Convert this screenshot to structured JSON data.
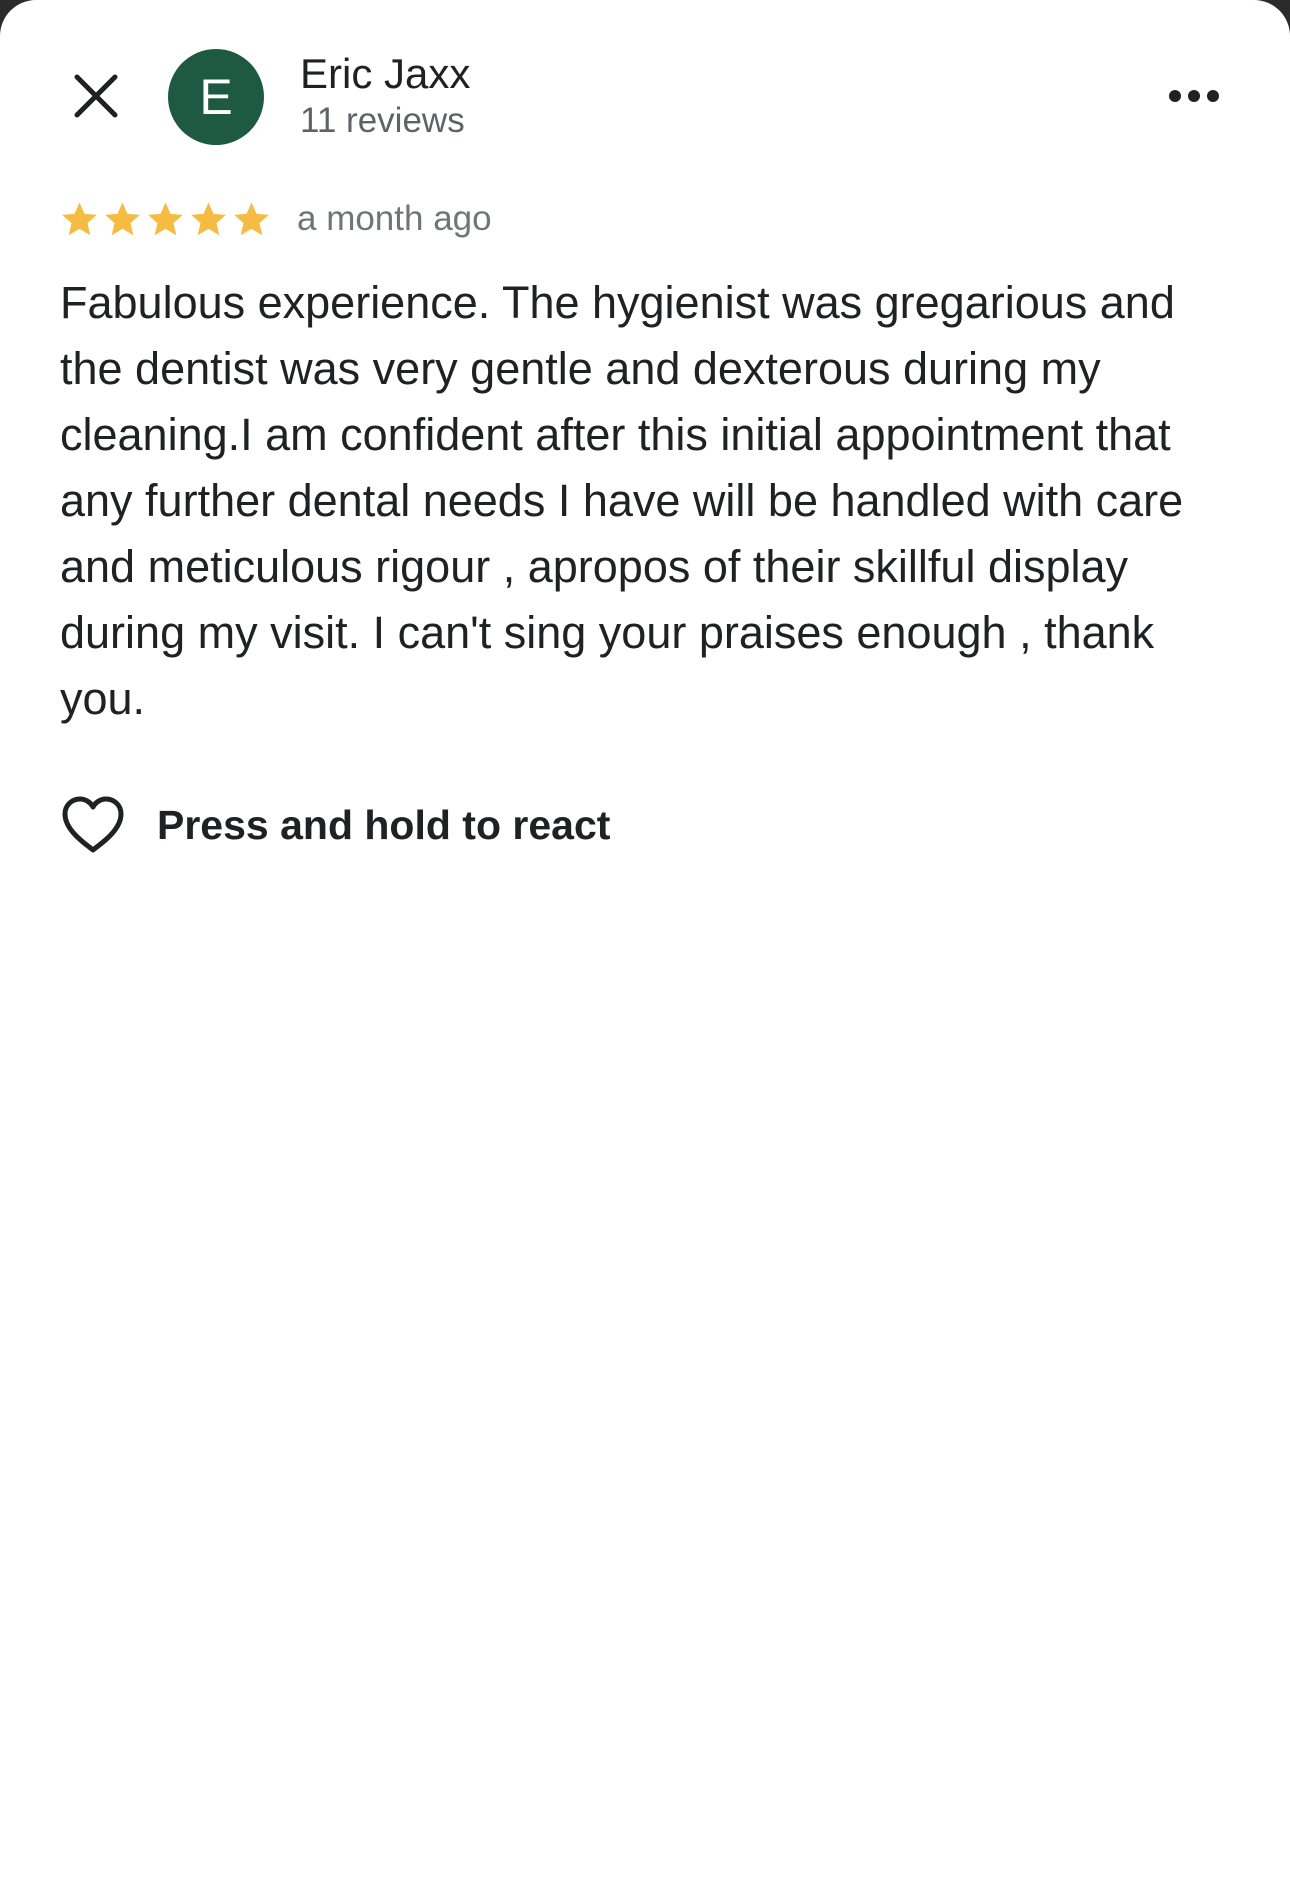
{
  "theme": {
    "avatar_bg": "#1e5944",
    "star_color": "#f6bb42",
    "text_primary": "#202124",
    "text_secondary": "#5f6368"
  },
  "header": {
    "close_icon": "close-icon",
    "more_icon": "more-horizontal-icon"
  },
  "reviewer": {
    "initial": "E",
    "name": "Eric Jaxx",
    "reviews_count": "11 reviews"
  },
  "review": {
    "rating": 5,
    "rating_max": 5,
    "time_ago": "a month ago",
    "text": "Fabulous experience. The hygienist was gregarious and the dentist was very gentle and dexterous during my cleaning.I am confident after this initial appointment that any further dental needs I have will be handled with care and meticulous rigour , apropos of their skillful display during my visit. I can't sing your praises enough , thank you."
  },
  "reaction": {
    "icon": "heart-outline-icon",
    "label": "Press and hold to react"
  }
}
